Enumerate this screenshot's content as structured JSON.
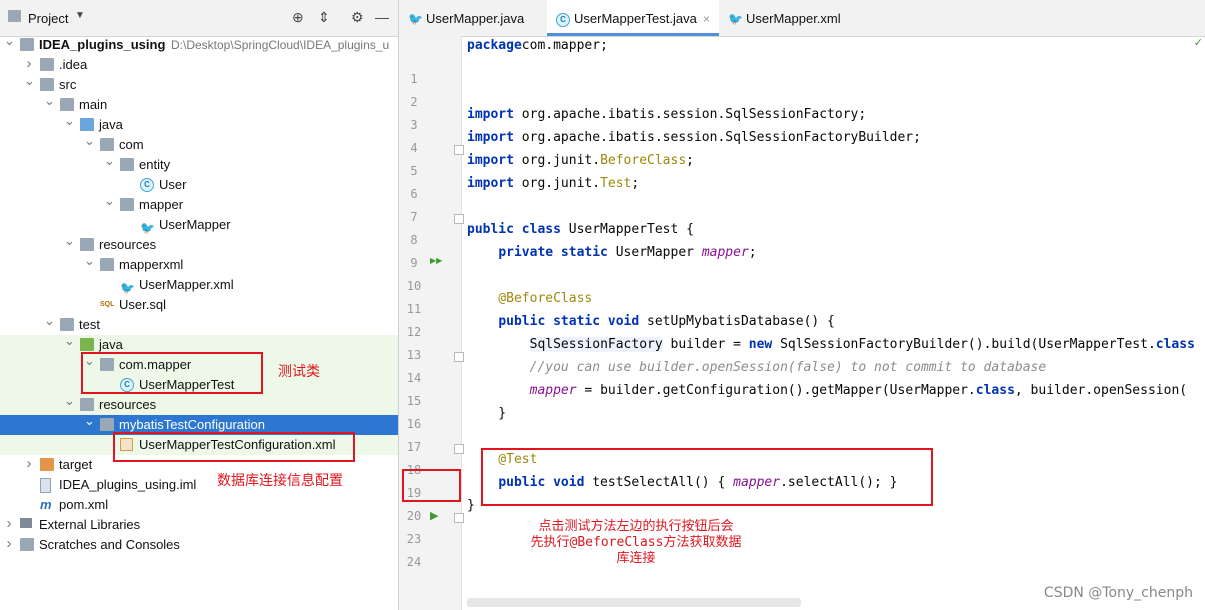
{
  "project_panel": {
    "title": "Project",
    "tree": [
      {
        "label": "IDEA_plugins_using",
        "path": "D:\\Desktop\\SpringCloud\\IDEA_plugins_u",
        "bold": true,
        "icon": "module-folder-icon",
        "expand": "down"
      },
      {
        "label": ".idea",
        "icon": "folder-icon",
        "expand": "right"
      },
      {
        "label": "src",
        "icon": "folder-icon",
        "expand": "down"
      },
      {
        "label": "main",
        "icon": "folder-icon",
        "expand": "down"
      },
      {
        "label": "java",
        "icon": "source-folder-icon",
        "expand": "down"
      },
      {
        "label": "com",
        "icon": "package-icon",
        "expand": "down"
      },
      {
        "label": "entity",
        "icon": "package-icon",
        "expand": "down"
      },
      {
        "label": "User",
        "icon": "class-icon",
        "expand": ""
      },
      {
        "label": "mapper",
        "icon": "package-icon",
        "expand": "down"
      },
      {
        "label": "UserMapper",
        "icon": "mybatis-bird-icon",
        "expand": ""
      },
      {
        "label": "resources",
        "icon": "resources-folder-icon",
        "expand": "down"
      },
      {
        "label": "mapperxml",
        "icon": "folder-icon",
        "expand": "down"
      },
      {
        "label": "UserMapper.xml",
        "icon": "mybatis-bird-icon",
        "expand": ""
      },
      {
        "label": "User.sql",
        "icon": "sql-file-icon",
        "expand": ""
      },
      {
        "label": "test",
        "icon": "folder-icon",
        "expand": "down"
      },
      {
        "label": "java",
        "icon": "test-source-folder-icon",
        "expand": "down"
      },
      {
        "label": "com.mapper",
        "icon": "package-icon",
        "expand": "down"
      },
      {
        "label": "UserMapperTest",
        "icon": "class-icon",
        "expand": ""
      },
      {
        "label": "resources",
        "icon": "test-resources-folder-icon",
        "expand": "down"
      },
      {
        "label": "mybatisTestConfiguration",
        "icon": "folder-icon",
        "expand": "down",
        "selected": true
      },
      {
        "label": "UserMapperTestConfiguration.xml",
        "icon": "xml-file-icon",
        "expand": ""
      },
      {
        "label": "target",
        "icon": "excluded-folder-icon",
        "expand": "right"
      },
      {
        "label": "IDEA_plugins_using.iml",
        "icon": "iml-file-icon",
        "expand": ""
      },
      {
        "label": "pom.xml",
        "icon": "maven-icon",
        "expand": ""
      },
      {
        "label": "External Libraries",
        "icon": "libraries-icon",
        "expand": "right"
      },
      {
        "label": "Scratches and Consoles",
        "icon": "scratches-icon",
        "expand": "right"
      }
    ]
  },
  "tabs": [
    {
      "label": "UserMapper.java",
      "icon": "interface-icon",
      "active": false
    },
    {
      "label": "UserMapperTest.java",
      "icon": "class-icon",
      "active": true
    },
    {
      "label": "UserMapper.xml",
      "icon": "mybatis-bird-icon",
      "active": false
    }
  ],
  "code": {
    "line_numbers": [
      "1",
      "2",
      "3",
      "4",
      "5",
      "6",
      "7",
      "8",
      "9",
      "10",
      "11",
      "12",
      "13",
      "14",
      "15",
      "16",
      "17",
      "18",
      "19",
      "20",
      "23",
      "24"
    ],
    "lines": [
      [
        [
          "kw",
          "package"
        ],
        [
          "",
          "com.mapper;"
        ]
      ],
      [],
      [],
      [
        [
          "kw",
          "import"
        ],
        [
          "",
          " org.apache.ibatis.session.SqlSessionFactory;"
        ]
      ],
      [
        [
          "kw",
          "import"
        ],
        [
          "",
          " org.apache.ibatis.session.SqlSessionFactoryBuilder;"
        ]
      ],
      [
        [
          "kw",
          "import"
        ],
        [
          "",
          " org.junit."
        ],
        [
          "ann",
          "BeforeClass"
        ],
        [
          "",
          ";"
        ]
      ],
      [
        [
          "kw",
          "import"
        ],
        [
          "",
          " org.junit."
        ],
        [
          "ann",
          "Test"
        ],
        [
          "",
          ";"
        ]
      ],
      [],
      [
        [
          "kw",
          "public class"
        ],
        [
          "",
          " UserMapperTest {"
        ]
      ],
      [
        [
          "",
          "    "
        ],
        [
          "kw",
          "private static"
        ],
        [
          "",
          " UserMapper "
        ],
        [
          "fld",
          "mapper"
        ],
        [
          "",
          ";"
        ]
      ],
      [],
      [
        [
          "ann",
          "    @BeforeClass"
        ]
      ],
      [
        [
          "",
          "    "
        ],
        [
          "kw",
          "public static void"
        ],
        [
          "",
          " setUpMybatisDatabase() {"
        ]
      ],
      [
        [
          "",
          "        "
        ],
        [
          "hl",
          "SqlSessionFactory"
        ],
        [
          "",
          " builder = "
        ],
        [
          "kw",
          "new"
        ],
        [
          "",
          " SqlSessionFactoryBuilder().build(UserMapperTest."
        ],
        [
          "kw",
          "class"
        ]
      ],
      [
        [
          "cmt",
          "        //you can use builder.openSession(false) to not commit to database"
        ]
      ],
      [
        [
          "",
          "        "
        ],
        [
          "fld",
          "mapper"
        ],
        [
          "",
          " = builder.getConfiguration().getMapper(UserMapper."
        ],
        [
          "kw",
          "class"
        ],
        [
          "",
          ", builder.openSession("
        ]
      ],
      [
        [
          "",
          "    }"
        ]
      ],
      [],
      [
        [
          "ann",
          "    @Test"
        ]
      ],
      [
        [
          "",
          "    "
        ],
        [
          "kw",
          "public void"
        ],
        [
          "",
          " testSelectAll() { "
        ],
        [
          "fld",
          "mapper"
        ],
        [
          "",
          ".selectAll(); }"
        ]
      ],
      [
        [
          "",
          "}"
        ]
      ],
      []
    ]
  },
  "annotations": {
    "test_class_note": "测试类",
    "config_note": "数据库连接信息配置",
    "run_note_line1": "点击测试方法左边的执行按钮后会",
    "run_note_line2": "先执行@BeforeClass方法获取数据",
    "run_note_line3": "库连接"
  },
  "watermark": "CSDN @Tony_chenph"
}
